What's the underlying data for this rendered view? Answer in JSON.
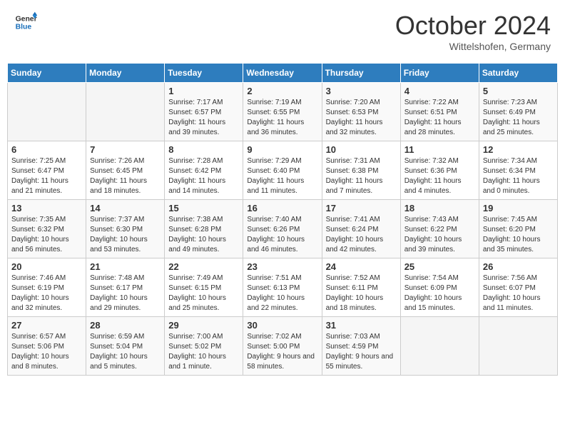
{
  "header": {
    "logo_general": "General",
    "logo_blue": "Blue",
    "month": "October 2024",
    "location": "Wittelshofen, Germany"
  },
  "days_of_week": [
    "Sunday",
    "Monday",
    "Tuesday",
    "Wednesday",
    "Thursday",
    "Friday",
    "Saturday"
  ],
  "weeks": [
    [
      {
        "day": "",
        "info": ""
      },
      {
        "day": "",
        "info": ""
      },
      {
        "day": "1",
        "info": "Sunrise: 7:17 AM\nSunset: 6:57 PM\nDaylight: 11 hours and 39 minutes."
      },
      {
        "day": "2",
        "info": "Sunrise: 7:19 AM\nSunset: 6:55 PM\nDaylight: 11 hours and 36 minutes."
      },
      {
        "day": "3",
        "info": "Sunrise: 7:20 AM\nSunset: 6:53 PM\nDaylight: 11 hours and 32 minutes."
      },
      {
        "day": "4",
        "info": "Sunrise: 7:22 AM\nSunset: 6:51 PM\nDaylight: 11 hours and 28 minutes."
      },
      {
        "day": "5",
        "info": "Sunrise: 7:23 AM\nSunset: 6:49 PM\nDaylight: 11 hours and 25 minutes."
      }
    ],
    [
      {
        "day": "6",
        "info": "Sunrise: 7:25 AM\nSunset: 6:47 PM\nDaylight: 11 hours and 21 minutes."
      },
      {
        "day": "7",
        "info": "Sunrise: 7:26 AM\nSunset: 6:45 PM\nDaylight: 11 hours and 18 minutes."
      },
      {
        "day": "8",
        "info": "Sunrise: 7:28 AM\nSunset: 6:42 PM\nDaylight: 11 hours and 14 minutes."
      },
      {
        "day": "9",
        "info": "Sunrise: 7:29 AM\nSunset: 6:40 PM\nDaylight: 11 hours and 11 minutes."
      },
      {
        "day": "10",
        "info": "Sunrise: 7:31 AM\nSunset: 6:38 PM\nDaylight: 11 hours and 7 minutes."
      },
      {
        "day": "11",
        "info": "Sunrise: 7:32 AM\nSunset: 6:36 PM\nDaylight: 11 hours and 4 minutes."
      },
      {
        "day": "12",
        "info": "Sunrise: 7:34 AM\nSunset: 6:34 PM\nDaylight: 11 hours and 0 minutes."
      }
    ],
    [
      {
        "day": "13",
        "info": "Sunrise: 7:35 AM\nSunset: 6:32 PM\nDaylight: 10 hours and 56 minutes."
      },
      {
        "day": "14",
        "info": "Sunrise: 7:37 AM\nSunset: 6:30 PM\nDaylight: 10 hours and 53 minutes."
      },
      {
        "day": "15",
        "info": "Sunrise: 7:38 AM\nSunset: 6:28 PM\nDaylight: 10 hours and 49 minutes."
      },
      {
        "day": "16",
        "info": "Sunrise: 7:40 AM\nSunset: 6:26 PM\nDaylight: 10 hours and 46 minutes."
      },
      {
        "day": "17",
        "info": "Sunrise: 7:41 AM\nSunset: 6:24 PM\nDaylight: 10 hours and 42 minutes."
      },
      {
        "day": "18",
        "info": "Sunrise: 7:43 AM\nSunset: 6:22 PM\nDaylight: 10 hours and 39 minutes."
      },
      {
        "day": "19",
        "info": "Sunrise: 7:45 AM\nSunset: 6:20 PM\nDaylight: 10 hours and 35 minutes."
      }
    ],
    [
      {
        "day": "20",
        "info": "Sunrise: 7:46 AM\nSunset: 6:19 PM\nDaylight: 10 hours and 32 minutes."
      },
      {
        "day": "21",
        "info": "Sunrise: 7:48 AM\nSunset: 6:17 PM\nDaylight: 10 hours and 29 minutes."
      },
      {
        "day": "22",
        "info": "Sunrise: 7:49 AM\nSunset: 6:15 PM\nDaylight: 10 hours and 25 minutes."
      },
      {
        "day": "23",
        "info": "Sunrise: 7:51 AM\nSunset: 6:13 PM\nDaylight: 10 hours and 22 minutes."
      },
      {
        "day": "24",
        "info": "Sunrise: 7:52 AM\nSunset: 6:11 PM\nDaylight: 10 hours and 18 minutes."
      },
      {
        "day": "25",
        "info": "Sunrise: 7:54 AM\nSunset: 6:09 PM\nDaylight: 10 hours and 15 minutes."
      },
      {
        "day": "26",
        "info": "Sunrise: 7:56 AM\nSunset: 6:07 PM\nDaylight: 10 hours and 11 minutes."
      }
    ],
    [
      {
        "day": "27",
        "info": "Sunrise: 6:57 AM\nSunset: 5:06 PM\nDaylight: 10 hours and 8 minutes."
      },
      {
        "day": "28",
        "info": "Sunrise: 6:59 AM\nSunset: 5:04 PM\nDaylight: 10 hours and 5 minutes."
      },
      {
        "day": "29",
        "info": "Sunrise: 7:00 AM\nSunset: 5:02 PM\nDaylight: 10 hours and 1 minute."
      },
      {
        "day": "30",
        "info": "Sunrise: 7:02 AM\nSunset: 5:00 PM\nDaylight: 9 hours and 58 minutes."
      },
      {
        "day": "31",
        "info": "Sunrise: 7:03 AM\nSunset: 4:59 PM\nDaylight: 9 hours and 55 minutes."
      },
      {
        "day": "",
        "info": ""
      },
      {
        "day": "",
        "info": ""
      }
    ]
  ]
}
